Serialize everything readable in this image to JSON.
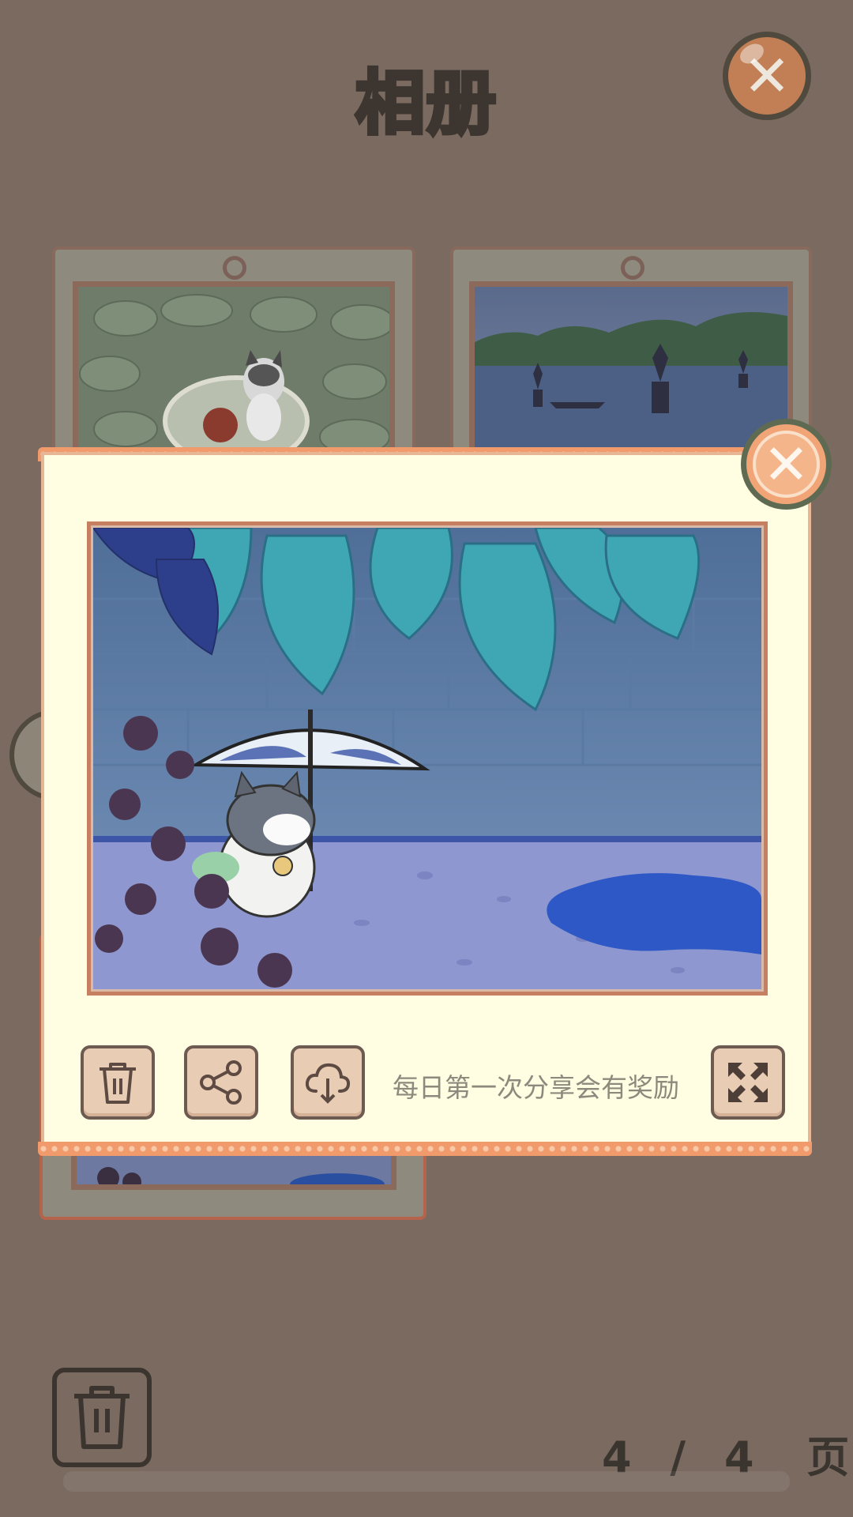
{
  "header": {
    "title": "相册",
    "close_icon": "close-icon"
  },
  "album": {
    "cards": [
      {
        "scene": "cat-in-pot",
        "icon": "photo-thumbnail"
      },
      {
        "scene": "lake-pagodas",
        "icon": "photo-thumbnail"
      },
      {
        "scene": "rain-puddle",
        "icon": "photo-thumbnail"
      }
    ]
  },
  "modal": {
    "close_icon": "close-icon",
    "photo_scene": "cat-with-umbrella-rain",
    "actions": {
      "delete_icon": "trash-icon",
      "share_icon": "share-icon",
      "download_icon": "cloud-download-icon",
      "fullscreen_icon": "expand-icon"
    },
    "hint": "每日第一次分享会有奖励"
  },
  "footer": {
    "delete_icon": "trash-icon",
    "page_current": "4",
    "page_sep": "/",
    "page_total": "4",
    "page_suffix": "页"
  },
  "colors": {
    "background": "#7a6a60",
    "modal_bg": "#fffee2",
    "accent_orange": "#f19a6c",
    "button_bg": "#e8ccb3"
  }
}
